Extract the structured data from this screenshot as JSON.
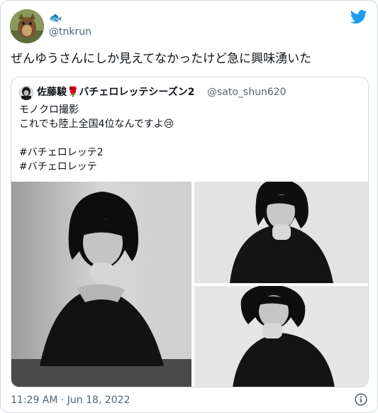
{
  "tweet": {
    "display_name_emoji": "🐟",
    "username": "@tnkrun",
    "text": "ぜんゆうさんにしか見えてなかったけど急に興味湧いた",
    "timestamp": "11:29 AM · Jun 18, 2022"
  },
  "quoted_tweet": {
    "name": "佐藤駿🌹バチェロレッテシーズン2",
    "handle": "@sato_shun620",
    "lines": [
      "モノクロ撮影",
      "これでも陸上全国4位なんですよ😢",
      "",
      "#バチェロレッテ2",
      "#バチェロレッテ"
    ],
    "photo_count": 3
  },
  "icons": {
    "brand": "twitter-bird-icon",
    "info": "info-icon"
  },
  "colors": {
    "twitter_blue": "#1d9bf0",
    "secondary_text": "#536471",
    "border": "#cfd9de"
  }
}
